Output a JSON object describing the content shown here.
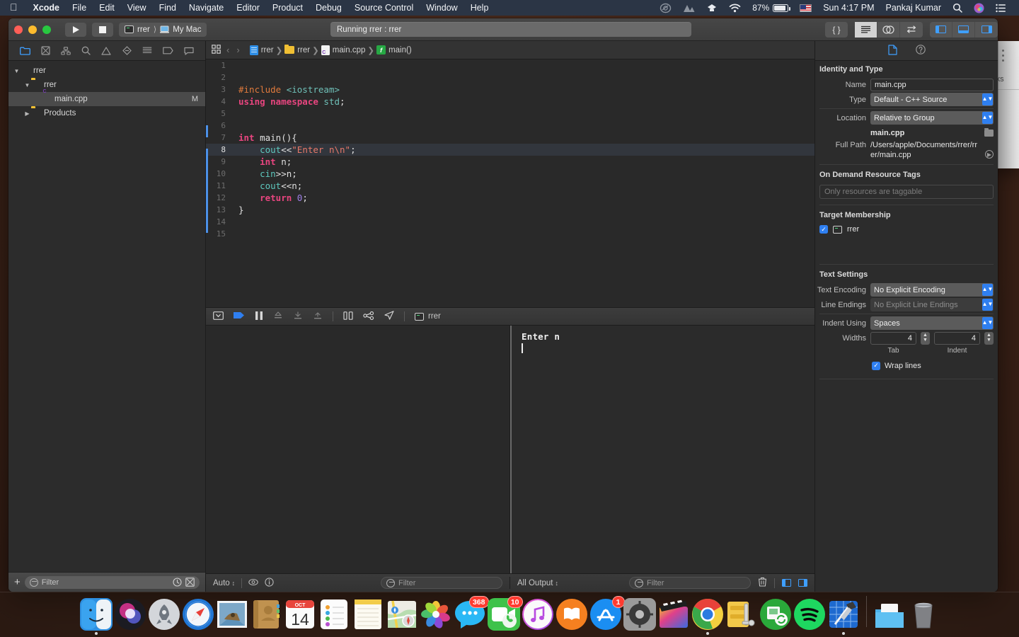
{
  "menubar": {
    "apple_icon": "apple-logo",
    "items": [
      {
        "label": "Xcode",
        "bold": true
      },
      {
        "label": "File",
        "bold": false
      },
      {
        "label": "Edit",
        "bold": false
      },
      {
        "label": "View",
        "bold": false
      },
      {
        "label": "Find",
        "bold": false
      },
      {
        "label": "Navigate",
        "bold": false
      },
      {
        "label": "Editor",
        "bold": false
      },
      {
        "label": "Product",
        "bold": false
      },
      {
        "label": "Debug",
        "bold": false
      },
      {
        "label": "Source Control",
        "bold": false
      },
      {
        "label": "Window",
        "bold": false
      },
      {
        "label": "Help",
        "bold": false
      }
    ],
    "status": {
      "creative_cloud_icon": "creative-cloud-icon",
      "mountain_icon": "mountain-icon",
      "dropbox_icon": "dropbox-icon",
      "wifi_icon": "wifi-icon",
      "battery_percent": "87%",
      "battery_icon": "battery-icon",
      "flag_icon": "us-flag-icon",
      "clock": "Sun 4:17 PM",
      "user": "Pankaj Kumar",
      "search_icon": "spotlight-search-icon",
      "siri_icon": "siri-icon",
      "control_center_icon": "notification-center-icon"
    }
  },
  "toolbar": {
    "close_label": "close",
    "minimize_label": "minimize",
    "zoom_label": "zoom",
    "run_icon": "play-icon",
    "stop_icon": "stop-icon",
    "scheme": {
      "target": "rrer",
      "destination": "My Mac"
    },
    "status": "Running rrer : rrer",
    "library_icon": "code-braces-icon",
    "editor_buttons": [
      "standard-editor-icon",
      "assistant-editor-icon",
      "version-editor-icon"
    ],
    "panel_buttons": [
      "toggle-navigator-icon",
      "toggle-debug-area-icon",
      "toggle-inspector-icon"
    ]
  },
  "navigator": {
    "tabs": [
      "project-navigator-icon",
      "source-control-navigator-icon",
      "symbol-navigator-icon",
      "find-navigator-icon",
      "issue-navigator-icon",
      "test-navigator-icon",
      "debug-navigator-icon",
      "breakpoint-navigator-icon",
      "report-navigator-icon"
    ],
    "tree": [
      {
        "label": "rrer",
        "icon": "xcode-project-icon",
        "depth": 0,
        "twisty": "▼",
        "badge": "",
        "selected": false
      },
      {
        "label": "rrer",
        "icon": "folder-icon",
        "depth": 1,
        "twisty": "▼",
        "badge": "",
        "selected": false
      },
      {
        "label": "main.cpp",
        "icon": "cpp-file-icon",
        "depth": 2,
        "twisty": "",
        "badge": "M",
        "selected": true
      },
      {
        "label": "Products",
        "icon": "folder-icon",
        "depth": 1,
        "twisty": "▶",
        "badge": "",
        "selected": false
      }
    ],
    "filter_placeholder": "Filter",
    "add_label": "+",
    "recent_icon": "clock-icon",
    "sourcecontrol_icon": "filter-scm-icon"
  },
  "jumpbar": {
    "related_icon": "related-items-icon",
    "back_icon": "‹",
    "forward_icon": "›",
    "crumbs": [
      {
        "label": "rrer",
        "icon": "xcode-project-icon"
      },
      {
        "label": "rrer",
        "icon": "folder-icon"
      },
      {
        "label": "main.cpp",
        "icon": "cpp-file-icon"
      },
      {
        "label": "main()",
        "icon": "function-icon"
      }
    ]
  },
  "editor": {
    "current_line": 8,
    "lines": [
      {
        "n": 1,
        "tokens": []
      },
      {
        "n": 2,
        "tokens": []
      },
      {
        "n": 3,
        "tokens": [
          {
            "t": "#include ",
            "c": "k-orange"
          },
          {
            "t": "<iostream>",
            "c": "k-teal"
          }
        ]
      },
      {
        "n": 4,
        "tokens": [
          {
            "t": "using ",
            "c": "k-pink"
          },
          {
            "t": "namespace ",
            "c": "k-pink"
          },
          {
            "t": "std",
            "c": "k-teal"
          },
          {
            "t": ";",
            "c": "k-white"
          }
        ]
      },
      {
        "n": 5,
        "tokens": []
      },
      {
        "n": 6,
        "tokens": []
      },
      {
        "n": 7,
        "tokens": [
          {
            "t": "int ",
            "c": "k-pink"
          },
          {
            "t": "main",
            "c": "k-white"
          },
          {
            "t": "(){",
            "c": "k-white"
          }
        ]
      },
      {
        "n": 8,
        "tokens": [
          {
            "t": "    ",
            "c": "k-white"
          },
          {
            "t": "cout",
            "c": "k-teal2"
          },
          {
            "t": "<<",
            "c": "k-white"
          },
          {
            "t": "\"Enter n\\n\"",
            "c": "k-str"
          },
          {
            "t": ";",
            "c": "k-white"
          }
        ]
      },
      {
        "n": 9,
        "tokens": [
          {
            "t": "    ",
            "c": "k-white"
          },
          {
            "t": "int ",
            "c": "k-pink"
          },
          {
            "t": "n;",
            "c": "k-white"
          }
        ]
      },
      {
        "n": 10,
        "tokens": [
          {
            "t": "    ",
            "c": "k-white"
          },
          {
            "t": "cin",
            "c": "k-teal2"
          },
          {
            "t": ">>n;",
            "c": "k-white"
          }
        ]
      },
      {
        "n": 11,
        "tokens": [
          {
            "t": "    ",
            "c": "k-white"
          },
          {
            "t": "cout",
            "c": "k-teal2"
          },
          {
            "t": "<<n;",
            "c": "k-white"
          }
        ]
      },
      {
        "n": 12,
        "tokens": [
          {
            "t": "    ",
            "c": "k-white"
          },
          {
            "t": "return ",
            "c": "k-pink"
          },
          {
            "t": "0",
            "c": "k-purple"
          },
          {
            "t": ";",
            "c": "k-white"
          }
        ]
      },
      {
        "n": 13,
        "tokens": [
          {
            "t": "}",
            "c": "k-white"
          }
        ]
      },
      {
        "n": 14,
        "tokens": []
      },
      {
        "n": 15,
        "tokens": []
      }
    ]
  },
  "debugbar": {
    "hide_icon": "hide-debug-area-icon",
    "continue_icon": "continue-execution-icon",
    "pause_icon": "pause-icon",
    "stepover_icon": "step-over-icon",
    "stepinto_icon": "step-into-icon",
    "stepout_icon": "step-out-icon",
    "viewdebug_icon": "debug-view-hierarchy-icon",
    "memgraph_icon": "memory-graph-icon",
    "location_icon": "simulate-location-icon",
    "process_icon": "terminal-icon",
    "process_label": "rrer"
  },
  "console": {
    "output_lines": [
      "Enter n"
    ],
    "cursor": true
  },
  "bottombar": {
    "scope_label": "Auto",
    "eye_icon": "show-variable-icon",
    "info_icon": "info-icon",
    "variables_filter_placeholder": "Filter",
    "output_scope_label": "All Output",
    "console_filter_placeholder": "Filter",
    "trash_icon": "clear-console-icon",
    "split_left_icon": "show-variables-view-icon",
    "split_right_icon": "show-console-view-icon"
  },
  "inspector": {
    "tabs": [
      "file-inspector-icon",
      "quick-help-icon"
    ],
    "identity": {
      "title": "Identity and Type",
      "name_label": "Name",
      "name_value": "main.cpp",
      "type_label": "Type",
      "type_value": "Default - C++ Source",
      "location_label": "Location",
      "location_value": "Relative to Group",
      "file_name": "main.cpp",
      "folder_icon": "choose-folder-icon",
      "fullpath_label": "Full Path",
      "fullpath_value": "/Users/apple/Documents/rrer/rrer/main.cpp",
      "reveal_icon": "reveal-in-finder-icon"
    },
    "ondemand": {
      "title": "On Demand Resource Tags",
      "placeholder": "Only resources are taggable"
    },
    "target": {
      "title": "Target Membership",
      "checked": true,
      "target_icon": "terminal-target-icon",
      "target_name": "rrer"
    },
    "textsettings": {
      "title": "Text Settings",
      "encoding_label": "Text Encoding",
      "encoding_value": "No Explicit Encoding",
      "lineendings_label": "Line Endings",
      "lineendings_value": "No Explicit Line Endings",
      "indent_label": "Indent Using",
      "indent_value": "Spaces",
      "widths_label": "Widths",
      "tab_width": "4",
      "indent_width": "4",
      "tab_sublabel": "Tab",
      "indent_sublabel": "Indent",
      "wrap_checked": true,
      "wrap_label": "Wrap lines"
    }
  },
  "bgwindow": {
    "label": "rks"
  },
  "dock": {
    "items": [
      {
        "name": "finder",
        "running": true,
        "badge": ""
      },
      {
        "name": "siri",
        "running": false,
        "badge": ""
      },
      {
        "name": "launchpad",
        "running": false,
        "badge": ""
      },
      {
        "name": "safari",
        "running": false,
        "badge": ""
      },
      {
        "name": "mail",
        "running": false,
        "badge": ""
      },
      {
        "name": "contacts",
        "running": false,
        "badge": ""
      },
      {
        "name": "calendar",
        "running": false,
        "badge": "",
        "date": "14",
        "month": "OCT"
      },
      {
        "name": "reminders",
        "running": false,
        "badge": ""
      },
      {
        "name": "notes",
        "running": false,
        "badge": ""
      },
      {
        "name": "maps",
        "running": false,
        "badge": ""
      },
      {
        "name": "photos",
        "running": false,
        "badge": ""
      },
      {
        "name": "messages",
        "running": false,
        "badge": "368"
      },
      {
        "name": "facetime",
        "running": false,
        "badge": "10"
      },
      {
        "name": "itunes",
        "running": false,
        "badge": ""
      },
      {
        "name": "ibooks",
        "running": false,
        "badge": ""
      },
      {
        "name": "app-store",
        "running": false,
        "badge": "1"
      },
      {
        "name": "system-preferences",
        "running": false,
        "badge": ""
      },
      {
        "name": "final-cut-pro",
        "running": false,
        "badge": ""
      },
      {
        "name": "google-chrome",
        "running": true,
        "badge": ""
      },
      {
        "name": "winzip",
        "running": false,
        "badge": ""
      },
      {
        "name": "file-transfer",
        "running": false,
        "badge": ""
      },
      {
        "name": "spotify",
        "running": false,
        "badge": ""
      },
      {
        "name": "xcode",
        "running": true,
        "badge": ""
      }
    ],
    "stack_name": "downloads-stack",
    "trash_name": "trash"
  }
}
